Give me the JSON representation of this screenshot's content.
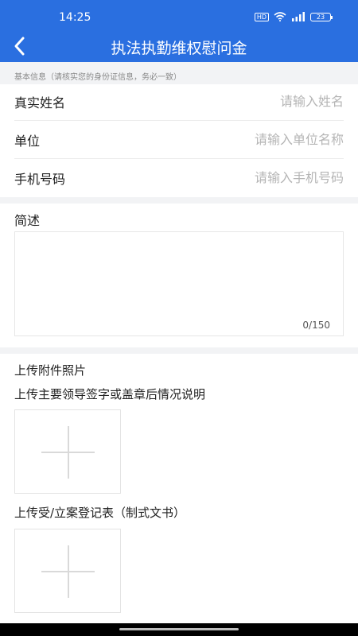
{
  "status": {
    "time": "14:25",
    "hd": "HD",
    "battery": "23"
  },
  "header": {
    "title": "执法执勤维权慰问金",
    "back_icon": "chevron-left-icon",
    "color": "#2a6fe0"
  },
  "hint": "基本信息（请核实您的身份证信息，务必一致）",
  "fields": [
    {
      "label": "真实姓名",
      "placeholder": "请输入姓名",
      "value": ""
    },
    {
      "label": "单位",
      "placeholder": "请输入单位名称",
      "value": ""
    },
    {
      "label": "手机号码",
      "placeholder": "请输入手机号码",
      "value": ""
    }
  ],
  "description": {
    "label": "简述",
    "value": "",
    "counter": "0/150"
  },
  "attachments": {
    "title": "上传附件照片",
    "items": [
      {
        "label": "上传主要领导签字或盖章后情况说明",
        "icon": "plus-icon"
      },
      {
        "label": "上传受/立案登记表（制式文书）",
        "icon": "plus-icon"
      }
    ]
  }
}
